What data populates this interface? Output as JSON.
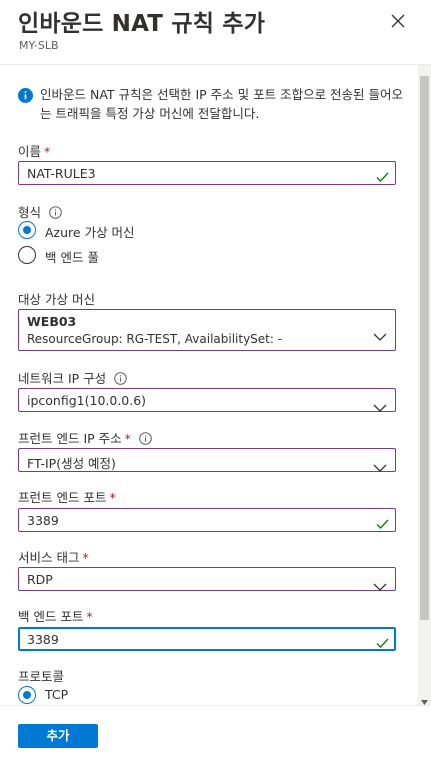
{
  "header": {
    "title": "인바운드 NAT 규칙 추가",
    "subtitle": "MY-SLB",
    "close_icon": "close-icon"
  },
  "info": {
    "icon": "info-icon",
    "text": "인바운드 NAT 규칙은 선택한 IP 주소 및 포트 조합으로 전송된 들어오는 트래픽을 특정 가상 머신에 전달합니다."
  },
  "form": {
    "name": {
      "label": "이름",
      "required": "*",
      "value": "NAT-RULE3",
      "valid_icon": "checkmark-icon"
    },
    "type": {
      "label": "형식",
      "options": [
        {
          "label": "Azure 가상 머신",
          "selected": true
        },
        {
          "label": "백 엔드 풀",
          "selected": false
        }
      ]
    },
    "target_vm": {
      "label": "대상 가상 머신",
      "value": "WEB03",
      "detail": "ResourceGroup: RG-TEST, AvailabilitySet: -"
    },
    "nic_ip": {
      "label": "네트워크 IP 구성",
      "value": "ipconfig1(10.0.0.6)"
    },
    "frontend_ip": {
      "label": "프런트 엔드 IP 주소",
      "required": "*",
      "value": "FT-IP(생성 예정)"
    },
    "frontend_port": {
      "label": "프런트 엔드 포트",
      "required": "*",
      "value": "3389"
    },
    "service_tag": {
      "label": "서비스 태그",
      "required": "*",
      "value": "RDP"
    },
    "backend_port": {
      "label": "백 엔드 포트",
      "required": "*",
      "value": "3389"
    },
    "protocol": {
      "label": "프로토콜",
      "options": [
        {
          "label": "TCP",
          "selected": true
        }
      ]
    }
  },
  "footer": {
    "add_label": "추가"
  },
  "colors": {
    "accent": "#0078d4",
    "required": "#a4262c",
    "valid_border": "#7a3a8a",
    "check": "#107c10"
  }
}
